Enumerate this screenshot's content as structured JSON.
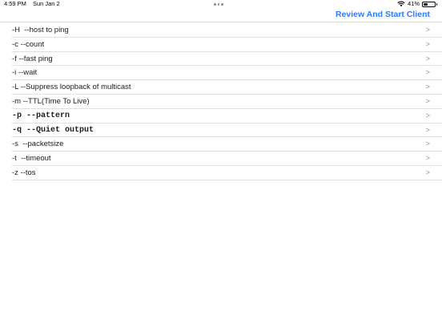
{
  "status_bar": {
    "time": "4:59 PM",
    "date": "Sun Jan 2",
    "battery_text": "41%",
    "battery_level": 0.41,
    "wifi_icon": "wifi-icon",
    "battery_icon": "battery-icon"
  },
  "nav": {
    "action_label": "Review And Start Client"
  },
  "options": [
    {
      "label": "-H  --host to ping",
      "chevron": ">"
    },
    {
      "label": "-c --count",
      "chevron": ">"
    },
    {
      "label": "-f --fast ping",
      "chevron": ">"
    },
    {
      "label": "-i --wait",
      "chevron": ">"
    },
    {
      "label": "-L --Suppress loopback of multicast",
      "chevron": ">"
    },
    {
      "label": "-m --TTL(Time To Live)",
      "chevron": ">"
    },
    {
      "label": "-p --pattern",
      "chevron": ">"
    },
    {
      "label": "-q --Quiet output",
      "chevron": ">"
    },
    {
      "label": "-s  --packetsize",
      "chevron": ">"
    },
    {
      "label": "-t  --timeout",
      "chevron": ">"
    },
    {
      "label": "-z --tos",
      "chevron": ">"
    }
  ],
  "colors": {
    "accent": "#2b7cf6",
    "separator": "#e0e0e4",
    "chevron": "#8e8e93"
  }
}
